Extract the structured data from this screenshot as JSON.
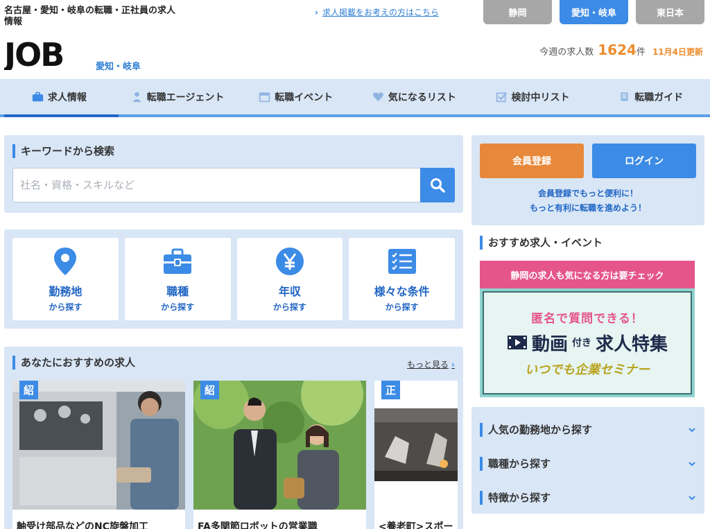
{
  "header": {
    "tagline": "名古屋・愛知・岐阜の転職・正社員の求人情報",
    "post_link": "求人掲載をお考えの方はこちら",
    "logo_text": "JOB",
    "logo_sub": "愛知・岐阜",
    "regions": [
      "静岡",
      "愛知・岐阜",
      "東日本"
    ],
    "active_region": "愛知・岐阜",
    "stats_label": "今週の求人数",
    "stats_count": "1624",
    "stats_unit": "件",
    "stats_updated": "11月4日更新"
  },
  "nav": {
    "items": [
      {
        "label": "求人情報",
        "icon": "briefcase-icon",
        "active": true
      },
      {
        "label": "転職エージェント",
        "icon": "person-icon"
      },
      {
        "label": "転職イベント",
        "icon": "calendar-icon"
      },
      {
        "label": "気になるリスト",
        "icon": "heart-icon"
      },
      {
        "label": "検討中リスト",
        "icon": "checkbox-icon"
      },
      {
        "label": "転職ガイド",
        "icon": "book-icon"
      }
    ]
  },
  "search": {
    "title": "キーワードから検索",
    "placeholder": "社名・資格・スキルなど"
  },
  "categories": [
    {
      "title": "勤務地",
      "sub": "から探す",
      "icon": "location-pin-icon"
    },
    {
      "title": "職種",
      "sub": "から探す",
      "icon": "briefcase-icon"
    },
    {
      "title": "年収",
      "sub": "から探す",
      "icon": "yen-icon"
    },
    {
      "title": "様々な条件",
      "sub": "から探す",
      "icon": "checklist-icon"
    }
  ],
  "recommended": {
    "title": "あなたにおすすめの求人",
    "more": "もっと見る",
    "cards": [
      {
        "badge": "紹",
        "title": "軸受け部品などのNC旋盤加工"
      },
      {
        "badge": "紹",
        "title": "FA多関節ロボットの営業職"
      },
      {
        "badge": "正",
        "title": "<養老町>スポー"
      }
    ]
  },
  "member": {
    "register": "会員登録",
    "login": "ログイン",
    "note_line1": "会員登録でもっと便利に！",
    "note_line2": "もっと有利に転職を進めよう！"
  },
  "events": {
    "title": "おすすめ求人・イベント",
    "banner_head": "静岡の求人も気になる方は要チェック",
    "banner_line1": "匿名で質問できる！",
    "banner_line2a": "動画",
    "banner_line2b": "付き",
    "banner_line2c": "求人特集",
    "banner_line3": "いつでも企業セミナー"
  },
  "browse": [
    {
      "label": "人気の勤務地から探す"
    },
    {
      "label": "職種から探す"
    },
    {
      "label": "特徴から探す"
    }
  ],
  "colors": {
    "accent": "#3c8be6",
    "orange": "#e8883a",
    "pink": "#e5558a",
    "panel": "#d8e6f6"
  }
}
